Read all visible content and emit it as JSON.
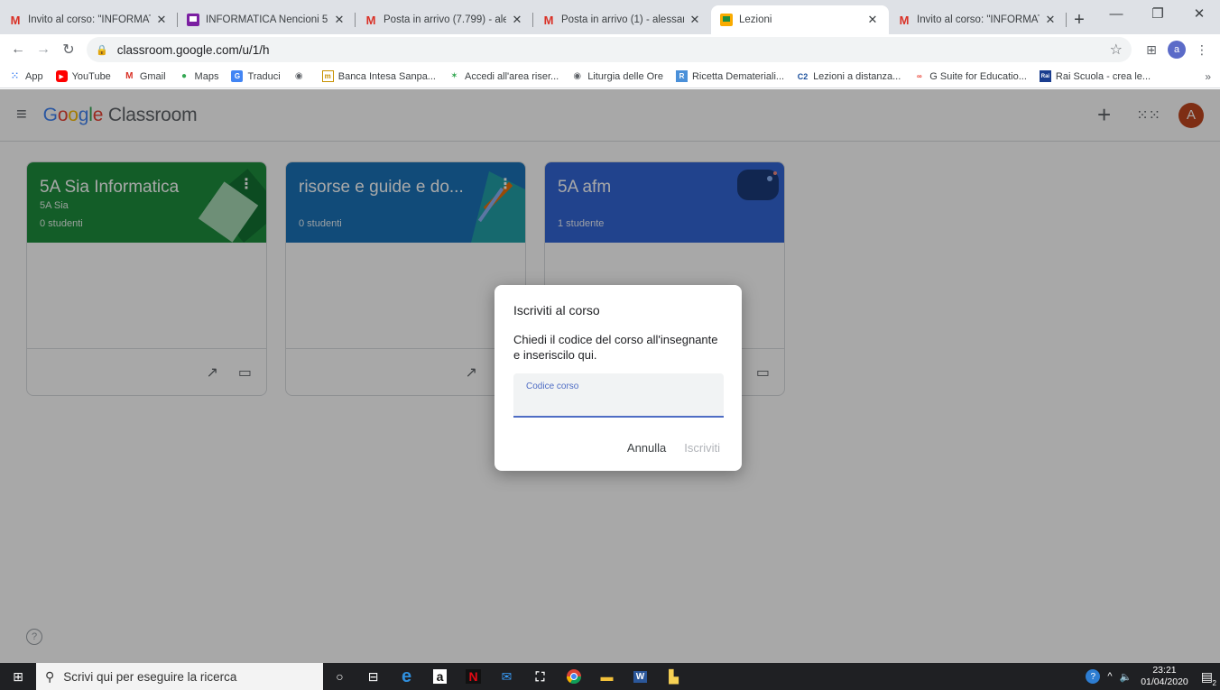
{
  "browser": {
    "tabs": [
      {
        "title": "Invito al corso: \"INFORMATIC",
        "favicon": "gmail-icon",
        "active": false
      },
      {
        "title": "INFORMATICA Nencioni 5D S",
        "favicon": "classroom-icon",
        "active": false
      },
      {
        "title": "Posta in arrivo (7.799) - aless",
        "favicon": "gmail-icon",
        "active": false
      },
      {
        "title": "Posta in arrivo (1) - alessandr",
        "favicon": "gmail-icon",
        "active": false
      },
      {
        "title": "Lezioni",
        "favicon": "classroom-icon",
        "active": true
      },
      {
        "title": "Invito al corso: \"INFORMATIC",
        "favicon": "gmail-icon",
        "active": false
      }
    ],
    "url": "classroom.google.com/u/1/h",
    "profile_initial": "a",
    "bookmarks": [
      "App",
      "YouTube",
      "Gmail",
      "Maps",
      "Traduci",
      "",
      "Banca Intesa Sanpa...",
      "Accedi all'area riser...",
      "Liturgia delle Ore",
      "Ricetta Demateriali...",
      "Lezioni a distanza...",
      "G Suite for Educatio...",
      "Rai Scuola - crea le..."
    ],
    "bookmarks_more": "»"
  },
  "app": {
    "brand_google": [
      "G",
      "o",
      "o",
      "g",
      "l",
      "e"
    ],
    "brand_product": "Classroom",
    "avatar_initial": "A",
    "cards": [
      {
        "title": "5A Sia Informatica",
        "subtitle": "5A Sia",
        "count": "0 studenti",
        "color": "#1e8e3e"
      },
      {
        "title": "risorse e guide e do...",
        "subtitle": "",
        "count": "0 studenti",
        "color": "#1a73b8"
      },
      {
        "title": "5A afm",
        "subtitle": "",
        "count": "1 studente",
        "color": "#3367d6"
      }
    ]
  },
  "dialog": {
    "title": "Iscriviti al corso",
    "text": "Chiedi il codice del corso all'insegnante e inseriscilo qui.",
    "field_label": "Codice corso",
    "field_value": "",
    "cancel_label": "Annulla",
    "join_label": "Iscriviti"
  },
  "taskbar": {
    "search_placeholder": "Scrivi qui per eseguire la ricerca",
    "time": "23:21",
    "date": "01/04/2020",
    "notifications": "2"
  }
}
